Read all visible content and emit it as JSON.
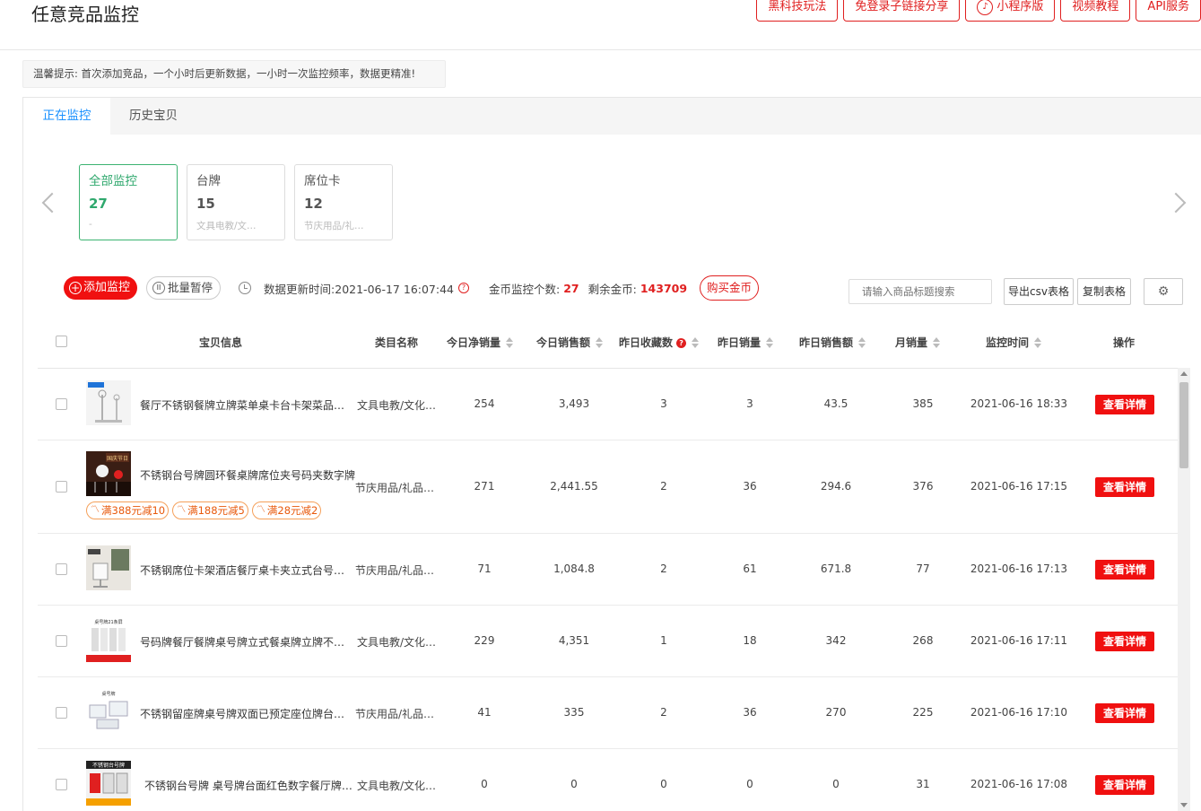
{
  "page": {
    "title": "任意竞品监控"
  },
  "top_buttons": [
    {
      "label": "黑科技玩法",
      "icon": ""
    },
    {
      "label": "免登录子链接分享",
      "icon": ""
    },
    {
      "label": "小程序版",
      "icon": "miniprogram-icon"
    },
    {
      "label": "视频教程",
      "icon": ""
    },
    {
      "label": "API服务",
      "icon": ""
    }
  ],
  "tip": "温馨提示: 首次添加竞品，一个小时后更新数据，一小时一次监控频率，数据更精准!",
  "tabs": [
    {
      "label": "正在监控",
      "active": true
    },
    {
      "label": "历史宝贝",
      "active": false
    }
  ],
  "cards": [
    {
      "title": "全部监控",
      "count": "27",
      "sub": "-",
      "active": true
    },
    {
      "title": "台牌",
      "count": "15",
      "sub": "文具电教/文…",
      "active": false
    },
    {
      "title": "席位卡",
      "count": "12",
      "sub": "节庆用品/礼…",
      "active": false
    }
  ],
  "toolbar": {
    "add_label": "添加监控",
    "pause_label": "批量暂停",
    "update_time": "数据更新时间:2021-06-17 16:07:44",
    "coin_label": "金币监控个数:",
    "coin_count": "27",
    "remain_label": "剩余金币:",
    "remain_coins": "143709",
    "buy_label": "购买金币",
    "search_placeholder": "请输入商品标题搜索",
    "csv_label": "导出csv表格",
    "copy_label": "复制表格"
  },
  "table": {
    "headers": {
      "item": "宝贝信息",
      "category": "类目名称",
      "today_net_sales": "今日净销量",
      "today_revenue": "今日销售额",
      "yesterday_favs": "昨日收藏数",
      "yesterday_sales": "昨日销量",
      "yesterday_revenue": "昨日销售额",
      "monthly_sales": "月销量",
      "monitor_time": "监控时间",
      "actions": "操作"
    },
    "detail_label": "查看详情",
    "rows": [
      {
        "title": "餐厅不锈钢餐牌立牌菜单桌卡台卡架菜品价格牌",
        "category": "文具电教/文化用品",
        "today_net_sales": "254",
        "today_revenue": "3,493",
        "yesterday_favs": "3",
        "yesterday_sales": "3",
        "yesterday_revenue": "43.5",
        "monthly_sales": "385",
        "monitor_time": "2021-06-16 18:33",
        "coupons": []
      },
      {
        "title": "不锈钢台号牌圆环餐桌牌席位夹号码夹数字牌",
        "category": "节庆用品/礼品/婚庆",
        "today_net_sales": "271",
        "today_revenue": "2,441.55",
        "yesterday_favs": "2",
        "yesterday_sales": "36",
        "yesterday_revenue": "294.6",
        "monthly_sales": "376",
        "monitor_time": "2021-06-16 17:15",
        "coupons": [
          "满388元减10",
          "满188元减5",
          "满28元减2"
        ]
      },
      {
        "title": "不锈钢席位卡架酒店餐厅桌卡夹立式台号牌座位牌",
        "category": "节庆用品/礼品/婚庆",
        "today_net_sales": "71",
        "today_revenue": "1,084.8",
        "yesterday_favs": "2",
        "yesterday_sales": "61",
        "yesterday_revenue": "671.8",
        "monthly_sales": "77",
        "monitor_time": "2021-06-16 17:13",
        "coupons": []
      },
      {
        "title": "号码牌餐厅餐牌桌号牌立式餐桌牌立牌不锈钢台卡",
        "category": "文具电教/文化用品",
        "today_net_sales": "229",
        "today_revenue": "4,351",
        "yesterday_favs": "1",
        "yesterday_sales": "18",
        "yesterday_revenue": "342",
        "monthly_sales": "268",
        "monitor_time": "2021-06-16 17:11",
        "coupons": []
      },
      {
        "title": "不锈钢留座牌桌号牌双面已预定座位牌台卡桌卡",
        "category": "节庆用品/礼品/婚庆",
        "today_net_sales": "41",
        "today_revenue": "335",
        "yesterday_favs": "2",
        "yesterday_sales": "36",
        "yesterday_revenue": "270",
        "monthly_sales": "225",
        "monitor_time": "2021-06-16 17:10",
        "coupons": []
      },
      {
        "title": "不锈钢台号牌 桌号牌台面红色数字餐厅牌号码牌",
        "category": "文具电教/文化用品",
        "today_net_sales": "0",
        "today_revenue": "0",
        "yesterday_favs": "0",
        "yesterday_sales": "0",
        "yesterday_revenue": "0",
        "monthly_sales": "31",
        "monitor_time": "2021-06-16 17:08",
        "coupons": []
      }
    ]
  },
  "thumb_labels": [
    "",
    "国庆节日",
    "",
    "桌号牌21条屏",
    "桌号牌",
    "不锈钢台号牌"
  ],
  "colors": {
    "accent_red": "#f01010",
    "active_green": "#2fa86d",
    "tab_blue": "#1890ff",
    "coupon_orange": "#e8590c"
  }
}
